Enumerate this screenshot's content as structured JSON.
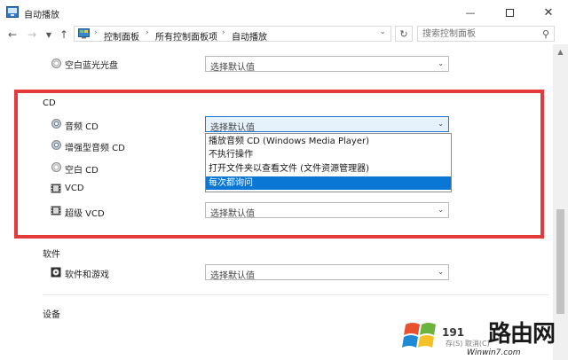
{
  "window": {
    "title": "自动播放",
    "minimize_icon": "minimize-icon",
    "maximize_icon": "maximize-icon",
    "close_icon": "close-icon"
  },
  "nav": {
    "breadcrumbs": [
      "控制面板",
      "所有控制面板项",
      "自动播放"
    ],
    "search_placeholder": "搜索控制面板"
  },
  "rows_top": [
    {
      "label": "空白蓝光光盘",
      "value": "选择默认值"
    }
  ],
  "cd_section": {
    "title": "CD",
    "rows": [
      {
        "label": "音频 CD",
        "value": "选择默认值",
        "active": true
      },
      {
        "label": "增强型音频 CD",
        "value": "选择默认值"
      },
      {
        "label": "空白 CD",
        "value": "选择默认值"
      },
      {
        "label": "VCD",
        "value": "选择默认值"
      },
      {
        "label": "超级 VCD",
        "value": "选择默认值"
      }
    ]
  },
  "dropdown": {
    "options": [
      "播放音频 CD (Windows Media Player)",
      "不执行操作",
      "打开文件夹以查看文件 (文件资源管理器)",
      "每次都询问"
    ],
    "selected_index": 3
  },
  "software_section": {
    "title": "软件",
    "rows": [
      {
        "label": "软件和游戏",
        "value": "选择默认值"
      }
    ]
  },
  "devices_section": {
    "title": "设备"
  },
  "watermark": {
    "site": "路由网",
    "domain": "Winwin7.com",
    "fragment": "191",
    "buttons_partial": "存(S) 取消(C)"
  },
  "colors": {
    "highlight_red": "#e33b3b",
    "selection_blue": "#0a77d5"
  }
}
